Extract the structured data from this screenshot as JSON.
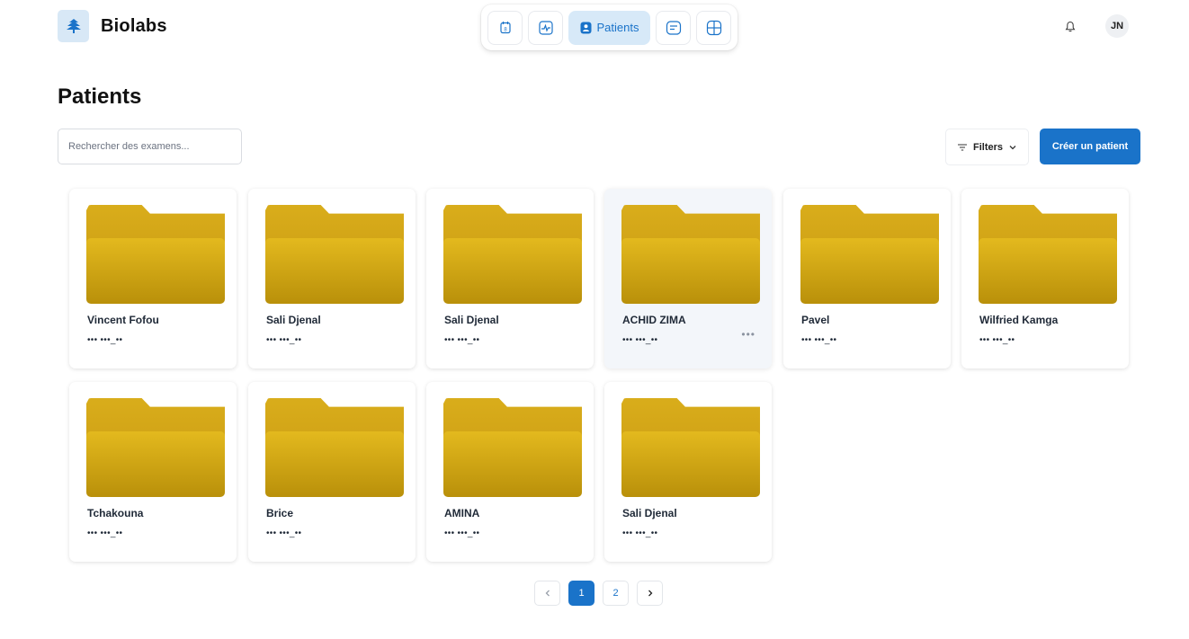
{
  "brand": {
    "name": "Biolabs",
    "icon": "tree-logo-icon"
  },
  "nav": {
    "items": [
      {
        "icon": "calendar-icon"
      },
      {
        "icon": "activity-icon"
      },
      {
        "icon": "patient-badge-icon",
        "label": "Patients",
        "active": true
      },
      {
        "icon": "message-icon"
      },
      {
        "icon": "layout-icon"
      }
    ]
  },
  "header": {
    "notification_icon": "bell-icon",
    "avatar_initials": "JN"
  },
  "page": {
    "title": "Patients"
  },
  "search": {
    "placeholder": "Rechercher des examens..."
  },
  "toolbar": {
    "filters_label": "Filters",
    "create_label": "Créer un patient"
  },
  "patients": [
    {
      "name": "Vincent Fofou",
      "id": "••• •••_••"
    },
    {
      "name": "Sali Djenal",
      "id": "••• •••_••"
    },
    {
      "name": "Sali Djenal",
      "id": "••• •••_••"
    },
    {
      "name": "ACHID ZIMA",
      "id": "••• •••_••",
      "more": "•••"
    },
    {
      "name": "Pavel",
      "id": "••• •••_••"
    },
    {
      "name": "Wilfried Kamga",
      "id": "••• •••_••"
    },
    {
      "name": "Tchakouna",
      "id": "••• •••_••"
    },
    {
      "name": "Brice",
      "id": "••• •••_••"
    },
    {
      "name": "AMINA",
      "id": "••• •••_••"
    },
    {
      "name": "Sali Djenal",
      "id": "••• •••_••"
    }
  ],
  "pagination": {
    "pages": [
      "1",
      "2"
    ],
    "current": "1"
  },
  "colors": {
    "accent": "#1a73c9",
    "folder": "#d9ad1b"
  }
}
